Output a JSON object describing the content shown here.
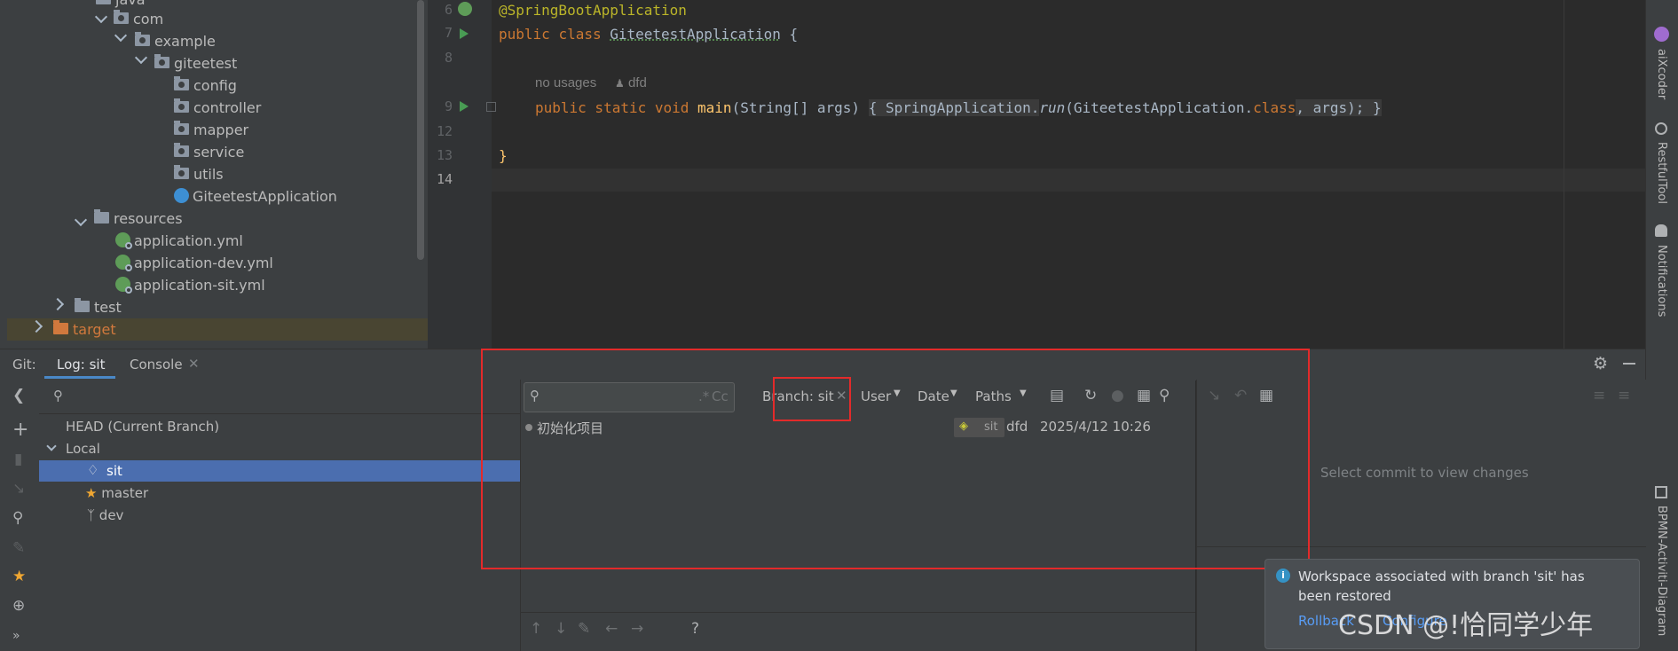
{
  "tree": {
    "items": [
      {
        "label": "java"
      },
      {
        "label": "com"
      },
      {
        "label": "example"
      },
      {
        "label": "giteetest"
      },
      {
        "label": "config"
      },
      {
        "label": "controller"
      },
      {
        "label": "mapper"
      },
      {
        "label": "service"
      },
      {
        "label": "utils"
      },
      {
        "label": "GiteetestApplication"
      },
      {
        "label": "resources"
      },
      {
        "label": "application.yml"
      },
      {
        "label": "application-dev.yml"
      },
      {
        "label": "application-sit.yml"
      },
      {
        "label": "test"
      },
      {
        "label": "target"
      }
    ]
  },
  "editor": {
    "line_numbers": [
      "6",
      "7",
      "8",
      "9",
      "12",
      "13",
      "14"
    ],
    "annotation": "@SpringBootApplication",
    "kw_public": "public",
    "kw_class": "class",
    "class_name": "GiteetestApplication",
    "brace_open": " {",
    "hint_usages": "no usages",
    "hint_author": "dfd",
    "kw_public_static_void": "public static void",
    "method_name": "main",
    "method_params": "(String[] args) ",
    "method_body_open": "{ SpringApplication.",
    "method_run": "run",
    "method_call_rest": "(GiteetestApplication.",
    "kw_class_ref": "class",
    "method_call_end": ", args); }",
    "brace_close": "}"
  },
  "right_strip": {
    "aixcoder": "aiXcoder",
    "restfultool": "RestfulTool",
    "notifications": "Notifications",
    "bpmn": "BPMN-Activiti-Diagram"
  },
  "git": {
    "label": "Git:",
    "tab_log": "Log: sit",
    "tab_console": "Console",
    "branches": {
      "head": "HEAD (Current Branch)",
      "local": "Local",
      "items": [
        "sit",
        "master",
        "dev"
      ]
    },
    "filter": {
      "regex": ".*",
      "case": "Cc",
      "branch": "Branch: sit",
      "user": "User",
      "date": "Date",
      "paths": "Paths"
    },
    "commits": [
      {
        "message": "初始化项目",
        "tag": "sit",
        "author": "dfd",
        "date": "2025/4/12 10:26"
      }
    ],
    "changes_placeholder": "Select commit to view changes",
    "bottom_help": "?"
  },
  "notification": {
    "text": "Workspace associated with branch 'sit' has been restored",
    "rollback": "Rollback",
    "configure": "Configure"
  },
  "watermark": "CSDN @!恰同学少年",
  "colors": {
    "accent": "#4b6eaf",
    "red_highlight": "#e32a2a",
    "selection": "#4b6eaf"
  }
}
